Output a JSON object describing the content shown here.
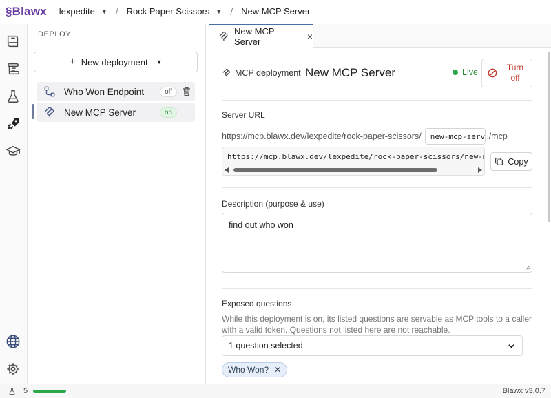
{
  "app": {
    "logo": "§Blawx",
    "breadcrumbs": [
      {
        "label": "lexpedite",
        "dropdown": true
      },
      {
        "label": "Rock Paper Scissors",
        "dropdown": true
      },
      {
        "label": "New MCP Server",
        "dropdown": false
      }
    ],
    "separator": "/"
  },
  "rail": {
    "icons": [
      "book-icon",
      "scroll-icon",
      "flask-icon",
      "rocket-icon",
      "graduation-cap-icon",
      "globe-icon",
      "gear-icon"
    ],
    "active": "rocket-icon"
  },
  "deploy_panel": {
    "title": "DEPLOY",
    "new_button": "New deployment",
    "items": [
      {
        "label": "Who Won Endpoint",
        "status": "off",
        "icon": "endpoint-icon"
      },
      {
        "label": "New MCP Server",
        "status": "on",
        "icon": "mcp-icon",
        "active": true
      }
    ]
  },
  "tab": {
    "label": "New MCP Server",
    "close": "×"
  },
  "main": {
    "type_label": "MCP deployment",
    "title": "New MCP Server",
    "live_label": "Live",
    "turn_off_label": "Turn off",
    "server_url_label": "Server URL",
    "url_prefix": "https://mcp.blawx.dev/lexpedite/rock-paper-scissors/",
    "slug": "new-mcp-server",
    "url_suffix": "/mcp",
    "full_url": "https://mcp.blawx.dev/lexpedite/rock-paper-scissors/new-mcp-server/mcp",
    "copy_label": "Copy",
    "description_label": "Description (purpose & use)",
    "description_value": "find out who won",
    "exposed_label": "Exposed questions",
    "exposed_help": "While this deployment is on, its listed questions are servable as MCP tools to a caller with a valid token. Questions not listed here are not reachable.",
    "select_value": "1 question selected",
    "chips": [
      "Who Won?"
    ]
  },
  "status_bar": {
    "count": "5",
    "progress": 1.0,
    "version": "Blawx v3.0.7"
  },
  "colors": {
    "brand": "#6a3ea1",
    "live": "#2aa84a",
    "danger": "#c0392b",
    "chip_bg": "#e5eef9"
  }
}
